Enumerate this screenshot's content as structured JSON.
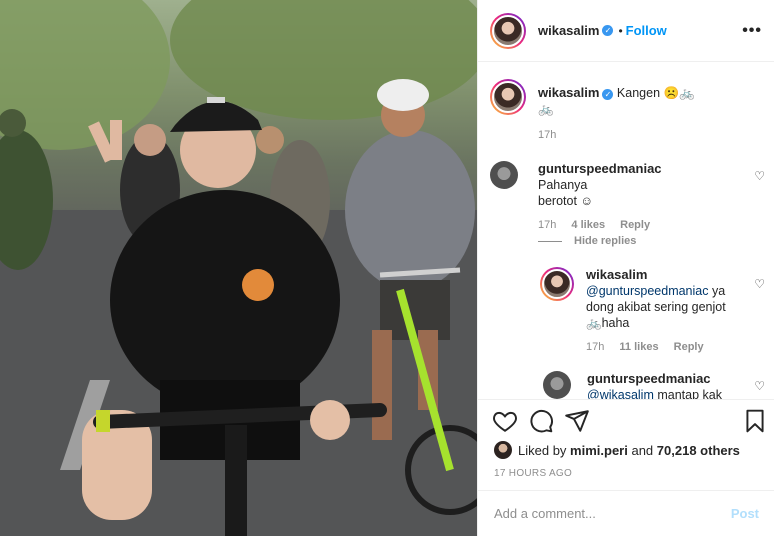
{
  "post": {
    "username": "wikasalim",
    "follow_label": "Follow",
    "more_label": "•••",
    "caption": {
      "username": "wikasalim",
      "text": "Kangen ☹️🚲",
      "emoji_line": "🚲",
      "time": "17h"
    }
  },
  "comments": [
    {
      "username": "gunturspeedmaniac",
      "text_line1": "Pahanya",
      "text_line2": "berotot ☺",
      "time": "17h",
      "likes": "4 likes",
      "reply_label": "Reply"
    },
    {
      "username": "wikasalim",
      "mention": "@gunturspeedmaniac",
      "text_after": "ya dong akibat sering genjot 🚲haha",
      "time": "17h",
      "likes": "11 likes",
      "reply_label": "Reply"
    },
    {
      "username": "gunturspeedmaniac",
      "mention": "@wikasalim",
      "text_after": "mantap kak"
    }
  ],
  "hide_replies_label": "Hide replies",
  "likes": {
    "prefix": "Liked by",
    "user": "mimi.peri",
    "and": "and",
    "count": "70,218 others"
  },
  "timestamp": "17 HOURS AGO",
  "add_comment": {
    "placeholder": "Add a comment...",
    "post_label": "Post"
  },
  "colors": {
    "accent": "#0095f6",
    "verified": "#3897f0",
    "muted": "#8e8e8e"
  },
  "icons": [
    "verified-badge-icon",
    "more-options-icon",
    "heart-icon",
    "comment-icon",
    "share-icon",
    "bookmark-icon",
    "bicycle-emoji"
  ]
}
